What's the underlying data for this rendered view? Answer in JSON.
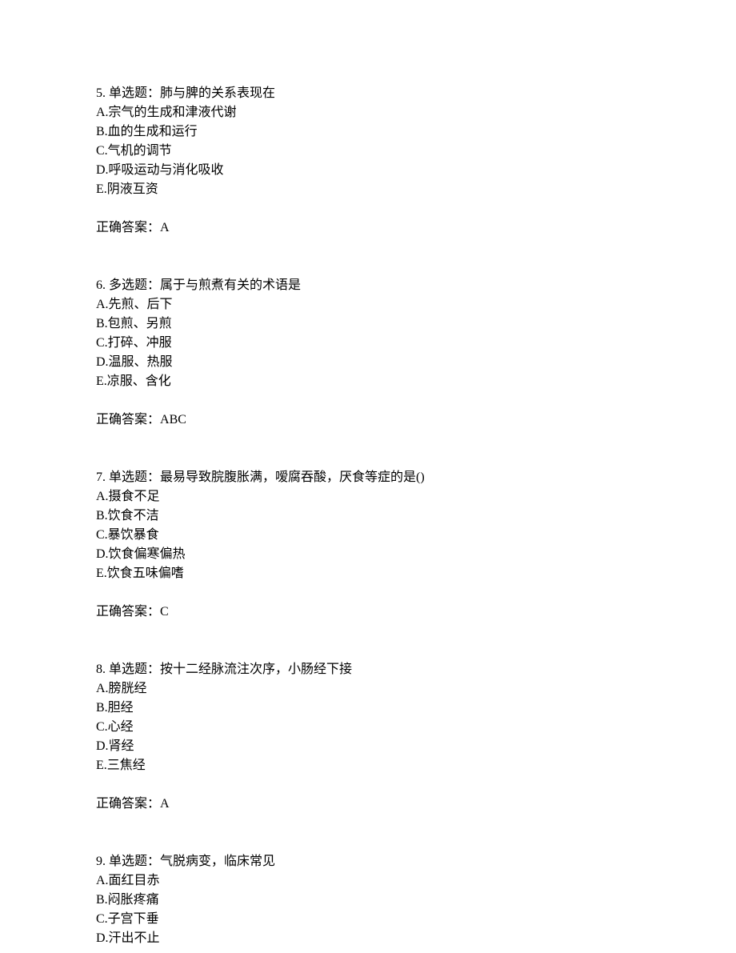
{
  "questions": [
    {
      "number": "5. ",
      "type": "单选题：",
      "stem": "肺与脾的关系表现在",
      "options": [
        "A.宗气的生成和津液代谢",
        "B.血的生成和运行",
        "C.气机的调节",
        "D.呼吸运动与消化吸收",
        "E.阴液互资"
      ],
      "answer_label": "正确答案：",
      "answer_value": "A"
    },
    {
      "number": "6. ",
      "type": "多选题：",
      "stem": "属于与煎煮有关的术语是",
      "options": [
        "A.先煎、后下",
        "B.包煎、另煎",
        "C.打碎、冲服",
        "D.温服、热服",
        "E.凉服、含化"
      ],
      "answer_label": "正确答案：",
      "answer_value": "ABC"
    },
    {
      "number": "7. ",
      "type": "单选题：",
      "stem": "最易导致脘腹胀满，嗳腐吞酸，厌食等症的是()",
      "options": [
        "A.摄食不足",
        "B.饮食不洁",
        "C.暴饮暴食",
        "D.饮食偏寒偏热",
        "E.饮食五味偏嗜"
      ],
      "answer_label": "正确答案：",
      "answer_value": "C"
    },
    {
      "number": "8. ",
      "type": "单选题：",
      "stem": "按十二经脉流注次序，小肠经下接",
      "options": [
        "A.膀胱经",
        "B.胆经",
        "C.心经",
        "D.肾经",
        "E.三焦经"
      ],
      "answer_label": "正确答案：",
      "answer_value": "A"
    },
    {
      "number": "9. ",
      "type": "单选题：",
      "stem": "气脱病变，临床常见",
      "options": [
        "A.面红目赤",
        "B.闷胀疼痛",
        "C.子宫下垂",
        "D.汗出不止"
      ],
      "answer_label": "",
      "answer_value": ""
    }
  ]
}
